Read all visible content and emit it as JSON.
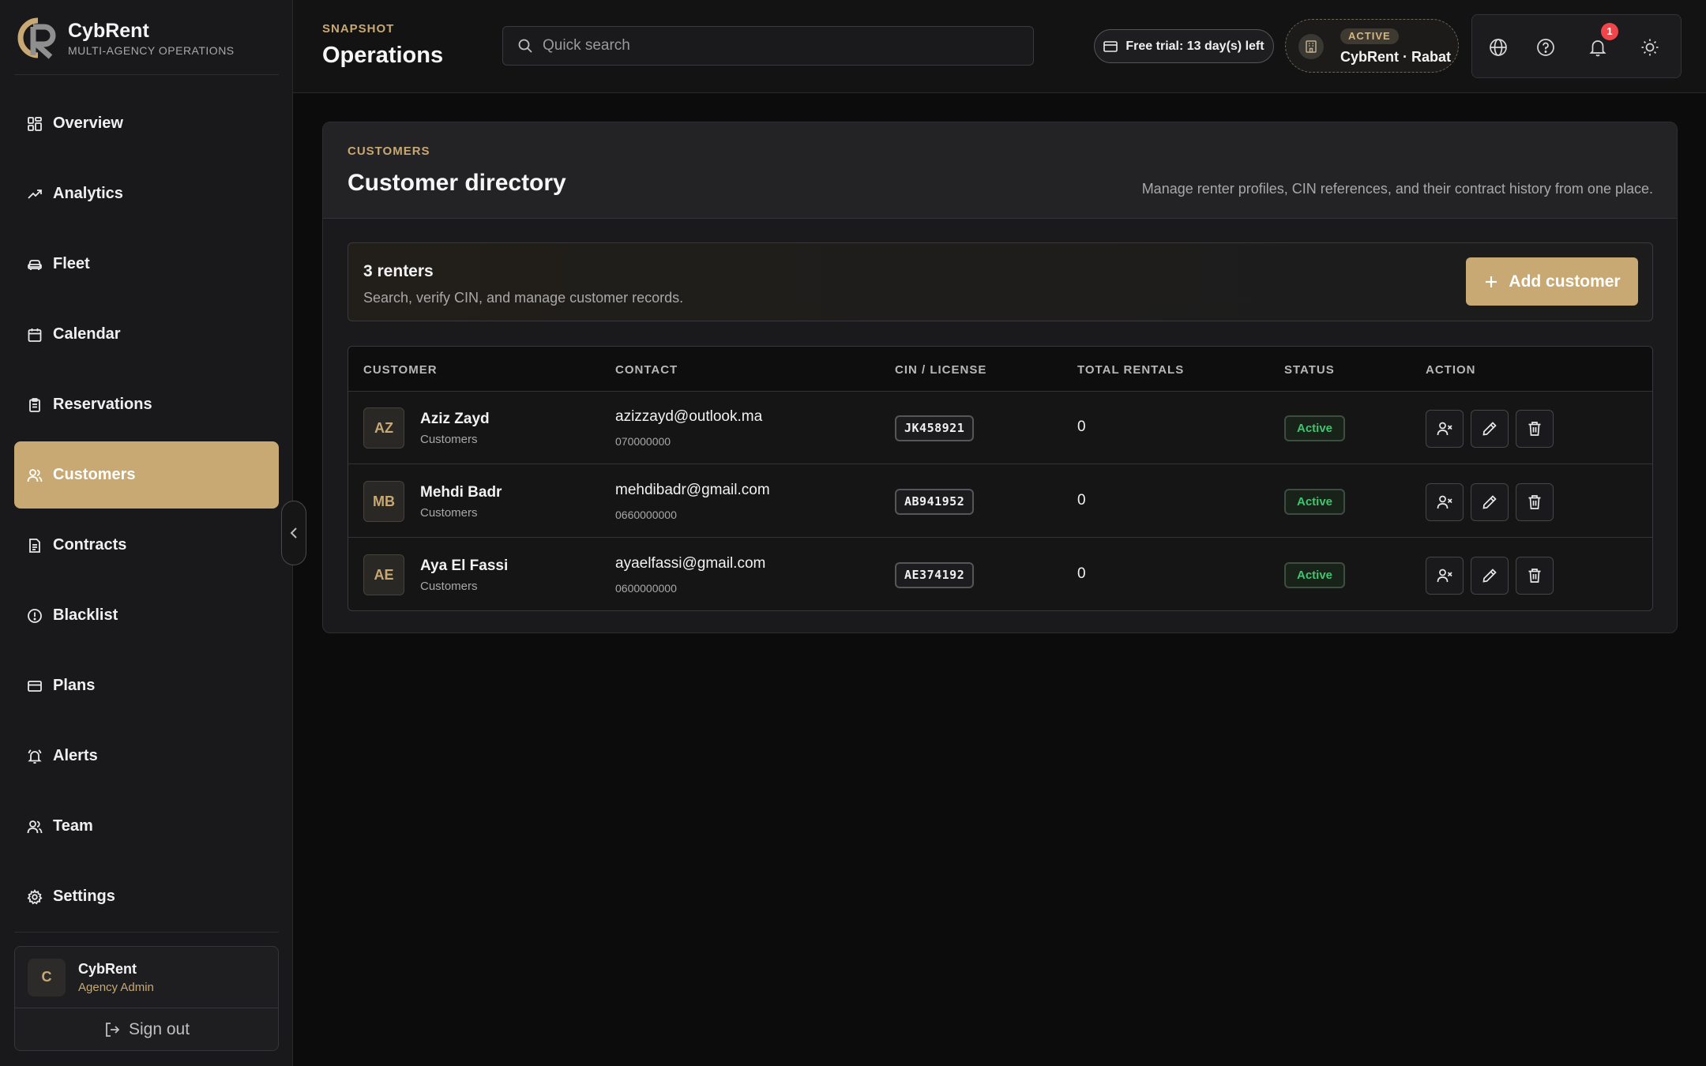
{
  "brand": {
    "name": "CybRent",
    "subtitle": "MULTI-AGENCY OPERATIONS"
  },
  "sidebar": {
    "items": [
      {
        "label": "Overview",
        "icon": "grid-icon"
      },
      {
        "label": "Analytics",
        "icon": "trend-up-icon"
      },
      {
        "label": "Fleet",
        "icon": "car-icon"
      },
      {
        "label": "Calendar",
        "icon": "calendar-icon"
      },
      {
        "label": "Reservations",
        "icon": "clipboard-icon"
      },
      {
        "label": "Customers",
        "icon": "users-icon",
        "active": true
      },
      {
        "label": "Contracts",
        "icon": "file-text-icon"
      },
      {
        "label": "Blacklist",
        "icon": "alert-circle-icon"
      },
      {
        "label": "Plans",
        "icon": "credit-card-icon"
      },
      {
        "label": "Alerts",
        "icon": "bell-ring-icon"
      },
      {
        "label": "Team",
        "icon": "users-icon"
      },
      {
        "label": "Settings",
        "icon": "gear-icon"
      }
    ]
  },
  "user": {
    "initial": "C",
    "name": "CybRent",
    "role": "Agency Admin",
    "signout": "Sign out"
  },
  "header": {
    "eyebrow": "SNAPSHOT",
    "title": "Operations",
    "search_placeholder": "Quick search",
    "trial": "Free trial: 13 day(s) left",
    "agency_status": "ACTIVE",
    "agency_name": "CybRent · Rabat",
    "notification_count": "1"
  },
  "card": {
    "eyebrow": "CUSTOMERS",
    "title": "Customer directory",
    "description": "Manage renter profiles, CIN references, and their contract history from one place.",
    "summary_count": "3 renters",
    "summary_desc": "Search, verify CIN, and manage customer records.",
    "add_button": "Add customer"
  },
  "table": {
    "headers": [
      "CUSTOMER",
      "CONTACT",
      "CIN / LICENSE",
      "TOTAL RENTALS",
      "STATUS",
      "ACTION"
    ],
    "rows": [
      {
        "initials": "AZ",
        "name": "Aziz Zayd",
        "type": "Customers",
        "email": "azizzayd@outlook.ma",
        "phone": "070000000",
        "cin": "JK458921",
        "rentals": "0",
        "status": "Active"
      },
      {
        "initials": "MB",
        "name": "Mehdi Badr",
        "type": "Customers",
        "email": "mehdibadr@gmail.com",
        "phone": "0660000000",
        "cin": "AB941952",
        "rentals": "0",
        "status": "Active"
      },
      {
        "initials": "AE",
        "name": "Aya El Fassi",
        "type": "Customers",
        "email": "ayaelfassi@gmail.com",
        "phone": "0600000000",
        "cin": "AE374192",
        "rentals": "0",
        "status": "Active"
      }
    ]
  },
  "colors": {
    "accent": "#c8a873",
    "active_green": "#3ec66e",
    "badge_red": "#f0454a"
  }
}
